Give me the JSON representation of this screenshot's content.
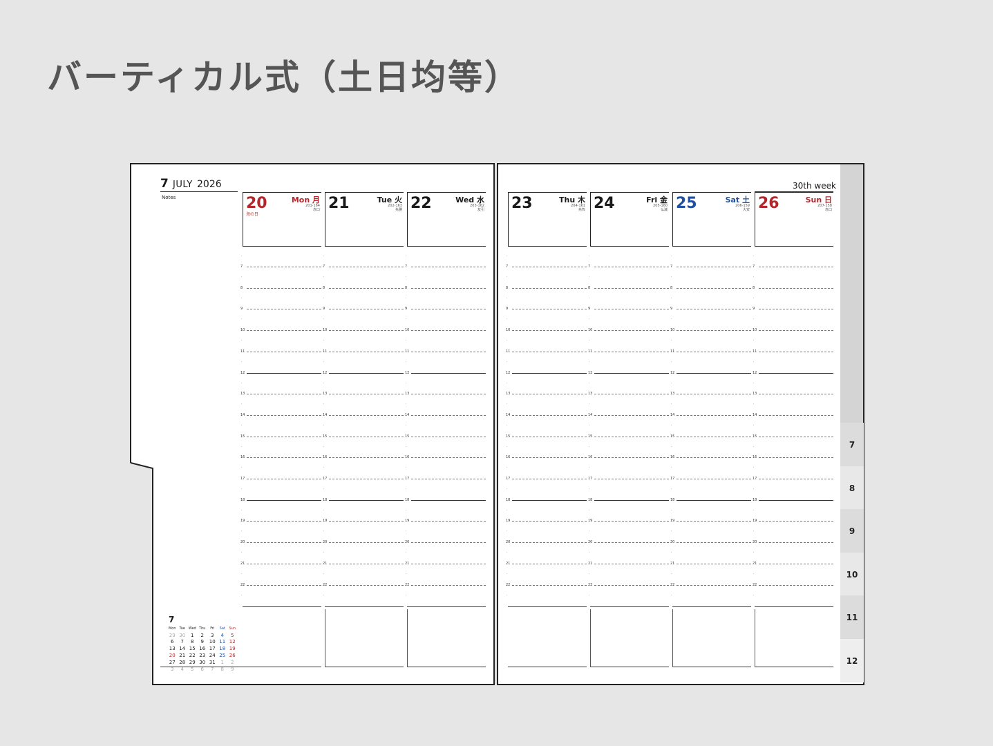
{
  "heading": "バーティカル式（土日均等）",
  "planner": {
    "month_num": "7",
    "month_name": "JULY",
    "year": "2026",
    "notes_label": "Notes",
    "week_label": "30th week",
    "days": [
      {
        "num": "20",
        "name": "Mon 月",
        "sub1": "201-164",
        "sub2": "赤口",
        "holiday": "海の日",
        "color": "red"
      },
      {
        "num": "21",
        "name": "Tue 火",
        "sub1": "202-163",
        "sub2": "先勝",
        "holiday": "",
        "color": "black"
      },
      {
        "num": "22",
        "name": "Wed 水",
        "sub1": "203-162",
        "sub2": "友引",
        "holiday": "",
        "color": "black"
      },
      {
        "num": "23",
        "name": "Thu 木",
        "sub1": "204-161",
        "sub2": "先負",
        "holiday": "",
        "color": "black"
      },
      {
        "num": "24",
        "name": "Fri 金",
        "sub1": "205-160",
        "sub2": "仏滅",
        "holiday": "",
        "color": "black"
      },
      {
        "num": "25",
        "name": "Sat 土",
        "sub1": "206-159",
        "sub2": "大安",
        "holiday": "",
        "color": "blue"
      },
      {
        "num": "26",
        "name": "Sun 日",
        "sub1": "207-158",
        "sub2": "赤口",
        "holiday": "",
        "color": "red"
      }
    ],
    "hours": [
      "7",
      "8",
      "9",
      "10",
      "11",
      "12",
      "13",
      "14",
      "15",
      "16",
      "17",
      "18",
      "19",
      "20",
      "21",
      "22"
    ],
    "tabs": [
      "7",
      "8",
      "9",
      "10",
      "11",
      "12"
    ],
    "mini_calendar": {
      "title": "7",
      "headers": [
        "Mon",
        "Tue",
        "Wed",
        "Thu",
        "Fri",
        "Sat",
        "Sun"
      ],
      "weeks": [
        [
          "29",
          "30",
          "1",
          "2",
          "3",
          "4",
          "5"
        ],
        [
          "6",
          "7",
          "8",
          "9",
          "10",
          "11",
          "12"
        ],
        [
          "13",
          "14",
          "15",
          "16",
          "17",
          "18",
          "19"
        ],
        [
          "20",
          "21",
          "22",
          "23",
          "24",
          "25",
          "26"
        ],
        [
          "27",
          "28",
          "29",
          "30",
          "31",
          "1",
          "2"
        ],
        [
          "3",
          "4",
          "5",
          "6",
          "7",
          "8",
          "9"
        ]
      ]
    }
  }
}
